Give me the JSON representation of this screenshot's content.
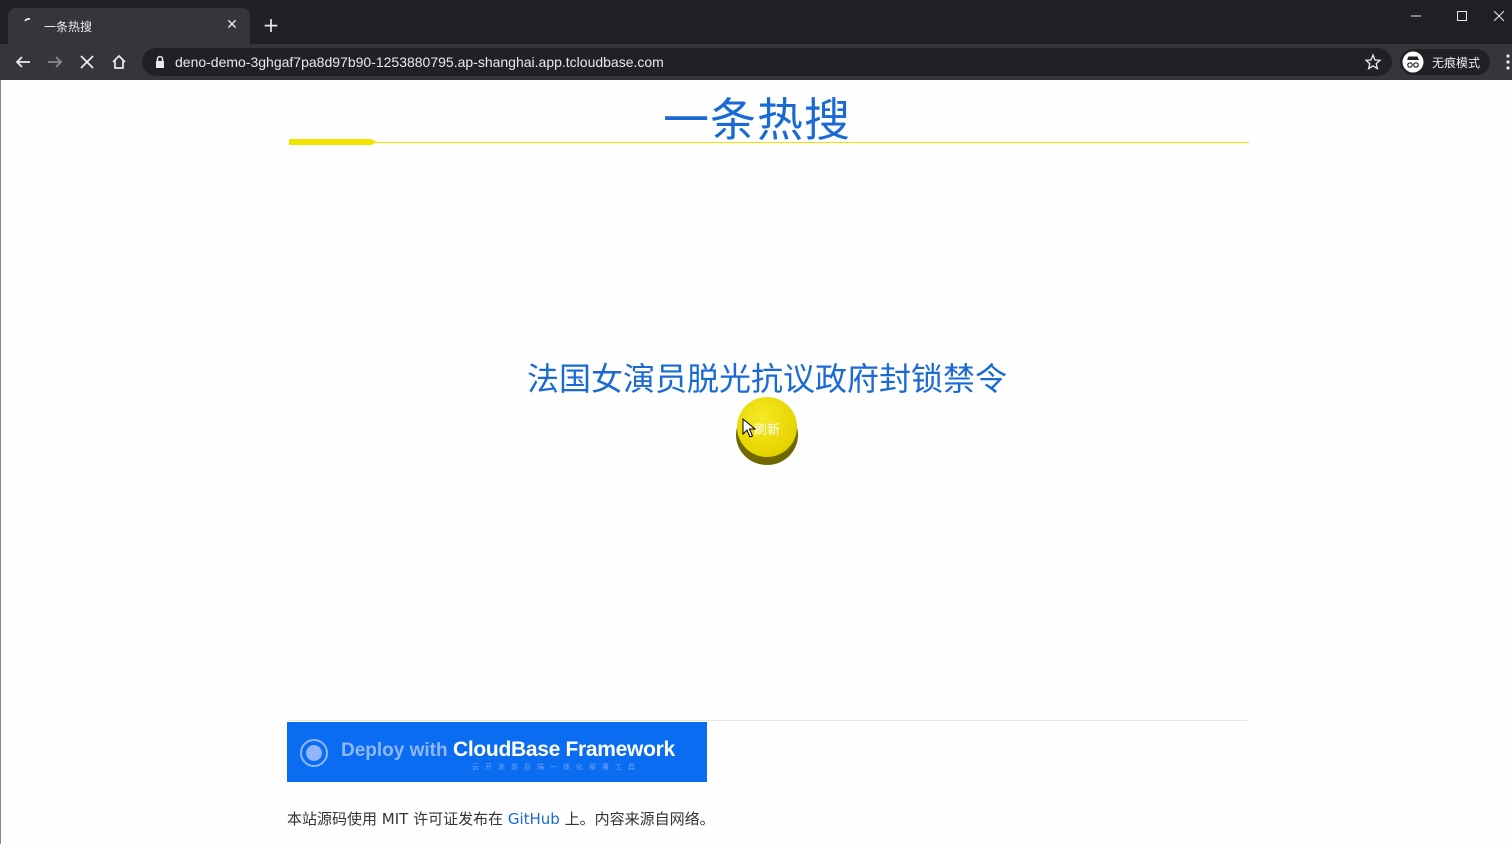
{
  "browser": {
    "tab_title": "一条热搜",
    "tab_close": "✕",
    "new_tab": "+",
    "url": "deno-demo-3ghgaf7pa8d97b90-1253880795.ap-shanghai.app.tcloudbase.com",
    "profile_label": "无痕模式"
  },
  "page": {
    "title": "一条热搜",
    "headline": "法国女演员脱光抗议政府封锁禁令",
    "refresh_label": "刷新"
  },
  "footer": {
    "badge_prefix": "Deploy with",
    "badge_brand": "CloudBase Framework",
    "badge_tagline": "云开发前后端一体化部署工具",
    "text_before": "本站源码使用 MIT 许可证发布在 ",
    "link_label": "GitHub",
    "text_after": " 上。内容来源自网络。"
  },
  "colors": {
    "accent_blue": "#1a6ad6",
    "accent_yellow": "#f2e400",
    "badge_blue": "#0a6cf0"
  }
}
